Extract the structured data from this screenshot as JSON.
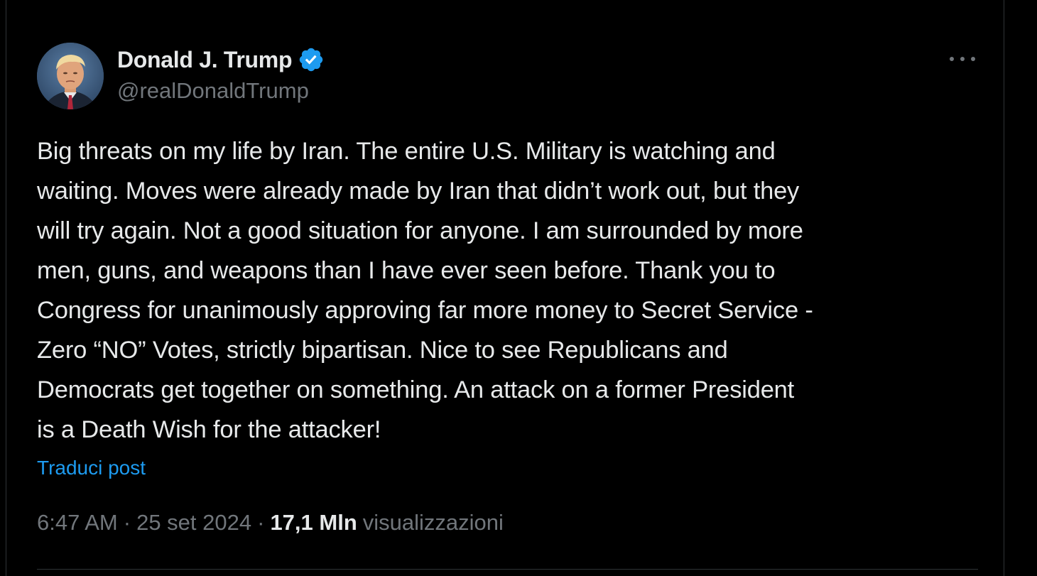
{
  "author": {
    "name": "Donald J. Trump",
    "handle": "@realDonaldTrump",
    "verified": true,
    "verified_icon": "verified-badge-icon",
    "verified_color": "#1d9bf0"
  },
  "tweet": {
    "text": "Big threats on my life by Iran. The entire U.S. Military is watching and\nwaiting. Moves were already made by Iran that didn’t work out, but they\nwill try again. Not a good situation for anyone. I am surrounded by more\nmen, guns, and weapons than I have ever seen before. Thank you to\nCongress for unanimously approving far more money to Secret Service -\nZero “NO” Votes, strictly bipartisan. Nice to see Republicans and\nDemocrats get together on something. An attack on a former President\nis a Death Wish for the attacker!",
    "translate_label": "Traduci post"
  },
  "meta": {
    "time": "6:47 AM",
    "separator": "·",
    "date": "25 set 2024",
    "views_count": "17,1 Mln",
    "views_label": "visualizzazioni"
  },
  "colors": {
    "background": "#000000",
    "text_primary": "#e7e9ea",
    "text_secondary": "#71767b",
    "link": "#1d9bf0",
    "border": "#2f3336"
  }
}
